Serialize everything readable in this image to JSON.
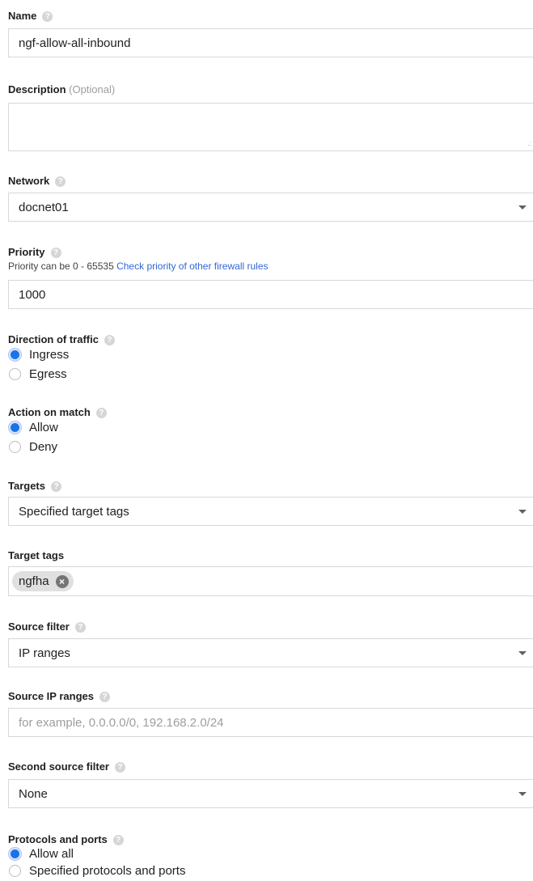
{
  "name": {
    "label": "Name",
    "value": "ngf-allow-all-inbound"
  },
  "description": {
    "label": "Description",
    "optional": "(Optional)",
    "value": ""
  },
  "network": {
    "label": "Network",
    "value": "docnet01"
  },
  "priority": {
    "label": "Priority",
    "hint": "Priority can be 0 - 65535",
    "hint_link": "Check priority of other firewall rules",
    "value": "1000"
  },
  "direction": {
    "label": "Direction of traffic",
    "options": [
      "Ingress",
      "Egress"
    ],
    "selected": "Ingress"
  },
  "action": {
    "label": "Action on match",
    "options": [
      "Allow",
      "Deny"
    ],
    "selected": "Allow"
  },
  "targets": {
    "label": "Targets",
    "value": "Specified target tags"
  },
  "target_tags": {
    "label": "Target tags",
    "tags": [
      "ngfha"
    ]
  },
  "source_filter": {
    "label": "Source filter",
    "value": "IP ranges"
  },
  "source_ip_ranges": {
    "label": "Source IP ranges",
    "placeholder": "for example, 0.0.0.0/0, 192.168.2.0/24",
    "value": ""
  },
  "second_source_filter": {
    "label": "Second source filter",
    "value": "None"
  },
  "protocols": {
    "label": "Protocols and ports",
    "options": [
      "Allow all",
      "Specified protocols and ports"
    ],
    "selected": "Allow all"
  },
  "colors": {
    "accent": "#1a73e8",
    "link": "#3367d6",
    "help_icon": "#d6d6d6"
  },
  "icons": {
    "help": "help-icon",
    "dropdown": "chevron-down-icon",
    "remove": "close-circle-icon"
  }
}
